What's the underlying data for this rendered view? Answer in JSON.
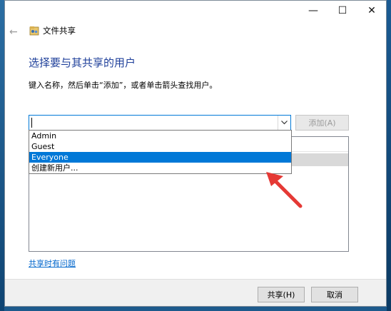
{
  "titlebar": {
    "minimize_glyph": "—",
    "maximize_glyph": "☐",
    "close_glyph": "✕"
  },
  "nav": {
    "back_glyph": "←"
  },
  "app": {
    "title": "文件共享"
  },
  "heading": "选择要与其共享的用户",
  "instruction": "键入名称，然后单击“添加”，或者单击箭头查找用户。",
  "combo": {
    "value": ""
  },
  "add_button": {
    "label": "添加(A)",
    "enabled": false
  },
  "dropdown": {
    "items": [
      "Admin",
      "Guest",
      "Everyone",
      "创建新用户..."
    ],
    "selected_index": 2
  },
  "help_link": "共享时有问题",
  "footer": {
    "share_label": "共享(H)",
    "cancel_label": "取消"
  },
  "colors": {
    "accent": "#0078d7",
    "heading": "#1e3f9a",
    "link": "#0066cc",
    "annotation_arrow": "#e53935"
  }
}
